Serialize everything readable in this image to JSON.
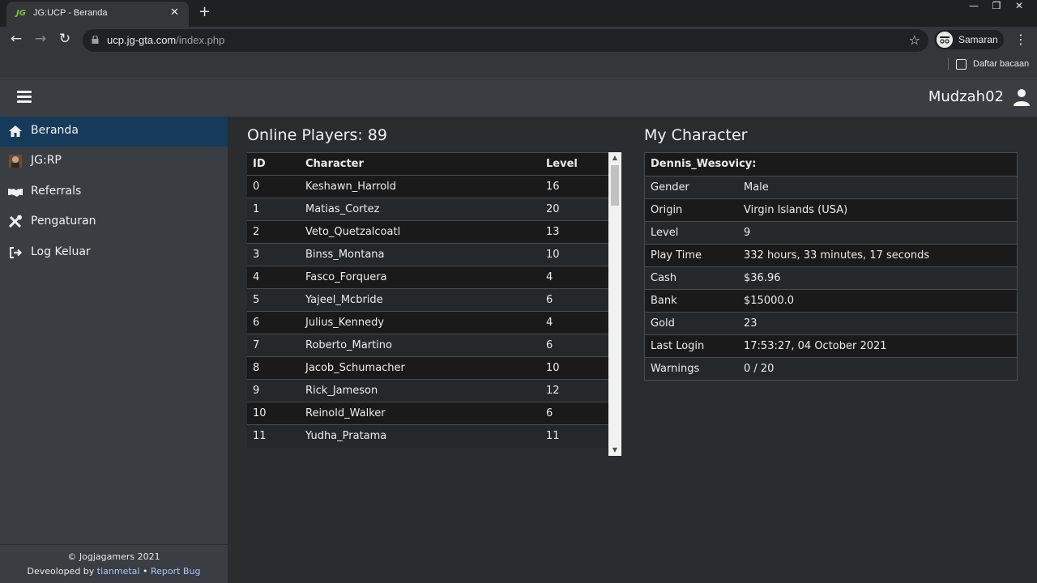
{
  "browser": {
    "tab_title": "JG:UCP - Beranda",
    "tab_favicon": "JG",
    "url_host": "ucp.jg-gta.com",
    "url_path": "/index.php",
    "profile_label": "Samaran",
    "reading_list_label": "Daftar bacaan"
  },
  "header": {
    "username": "Mudzah02"
  },
  "sidebar": {
    "items": [
      {
        "label": "Beranda",
        "icon": "home-icon"
      },
      {
        "label": "JG:RP",
        "icon": "game-icon"
      },
      {
        "label": "Referrals",
        "icon": "handshake-icon"
      },
      {
        "label": "Pengaturan",
        "icon": "tools-icon"
      },
      {
        "label": "Log Keluar",
        "icon": "logout-icon"
      }
    ],
    "footer": {
      "copyright": "© Jogjagamers 2021",
      "dev_prefix": "Deveoloped by ",
      "dev_name": "tianmetal",
      "separator": " • ",
      "report_bug": "Report Bug"
    }
  },
  "players": {
    "title": "Online Players: 89",
    "headers": [
      "ID",
      "Character",
      "Level"
    ],
    "rows": [
      [
        "0",
        "Keshawn_Harrold",
        "16"
      ],
      [
        "1",
        "Matias_Cortez",
        "20"
      ],
      [
        "2",
        "Veto_Quetzalcoatl",
        "13"
      ],
      [
        "3",
        "Binss_Montana",
        "10"
      ],
      [
        "4",
        "Fasco_Forquera",
        "4"
      ],
      [
        "5",
        "Yajeel_Mcbride",
        "6"
      ],
      [
        "6",
        "Julius_Kennedy",
        "4"
      ],
      [
        "7",
        "Roberto_Martino",
        "6"
      ],
      [
        "8",
        "Jacob_Schumacher",
        "10"
      ],
      [
        "9",
        "Rick_Jameson",
        "12"
      ],
      [
        "10",
        "Reinold_Walker",
        "6"
      ],
      [
        "11",
        "Yudha_Pratama",
        "11"
      ]
    ]
  },
  "character": {
    "title": "My Character",
    "name": "Dennis_Wesovicy:",
    "rows": [
      [
        "Gender",
        "Male"
      ],
      [
        "Origin",
        "Virgin Islands (USA)"
      ],
      [
        "Level",
        "9"
      ],
      [
        "Play Time",
        "332 hours, 33 minutes, 17 seconds"
      ],
      [
        "Cash",
        "$36.96"
      ],
      [
        "Bank",
        "$15000.0"
      ],
      [
        "Gold",
        "23"
      ],
      [
        "Last Login",
        "17:53:27, 04 October 2021"
      ],
      [
        "Warnings",
        "0 / 20"
      ]
    ]
  }
}
